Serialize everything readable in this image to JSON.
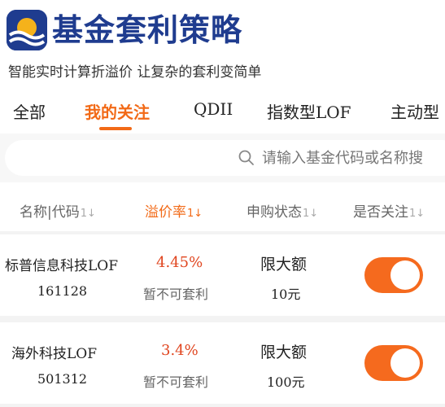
{
  "header": {
    "title": "基金套利策略",
    "subtitle": "智能实时计算折溢价 让复杂的套利变简单",
    "logo_icon": "fund-arbitrage-logo"
  },
  "tabs": [
    {
      "label": "全部"
    },
    {
      "label": "我的关注",
      "active": true
    },
    {
      "label": "QDII"
    },
    {
      "label": "指数型LOF"
    },
    {
      "label": "主动型"
    }
  ],
  "search": {
    "placeholder": "请输入基金代码或名称搜"
  },
  "table": {
    "columns": [
      {
        "label": "名称|代码",
        "sort": "1↓"
      },
      {
        "label": "溢价率",
        "sort": "1↓",
        "active": true
      },
      {
        "label": "申购状态",
        "sort": "1↓"
      },
      {
        "label": "是否关注",
        "sort": "1↓"
      }
    ],
    "rows": [
      {
        "name": "标普信息科技LOF",
        "code": "161128",
        "premium": "4.45%",
        "arb_status": "暂不可套利",
        "purchase_status": "限大额",
        "limit": "10元",
        "followed": true
      },
      {
        "name": "海外科技LOF",
        "code": "501312",
        "premium": "3.4%",
        "arb_status": "暂不可套利",
        "purchase_status": "限大额",
        "limit": "100元",
        "followed": true
      }
    ]
  },
  "colors": {
    "accent": "#f26a17",
    "premium": "#e0451f",
    "brand": "#1f3c8f"
  }
}
